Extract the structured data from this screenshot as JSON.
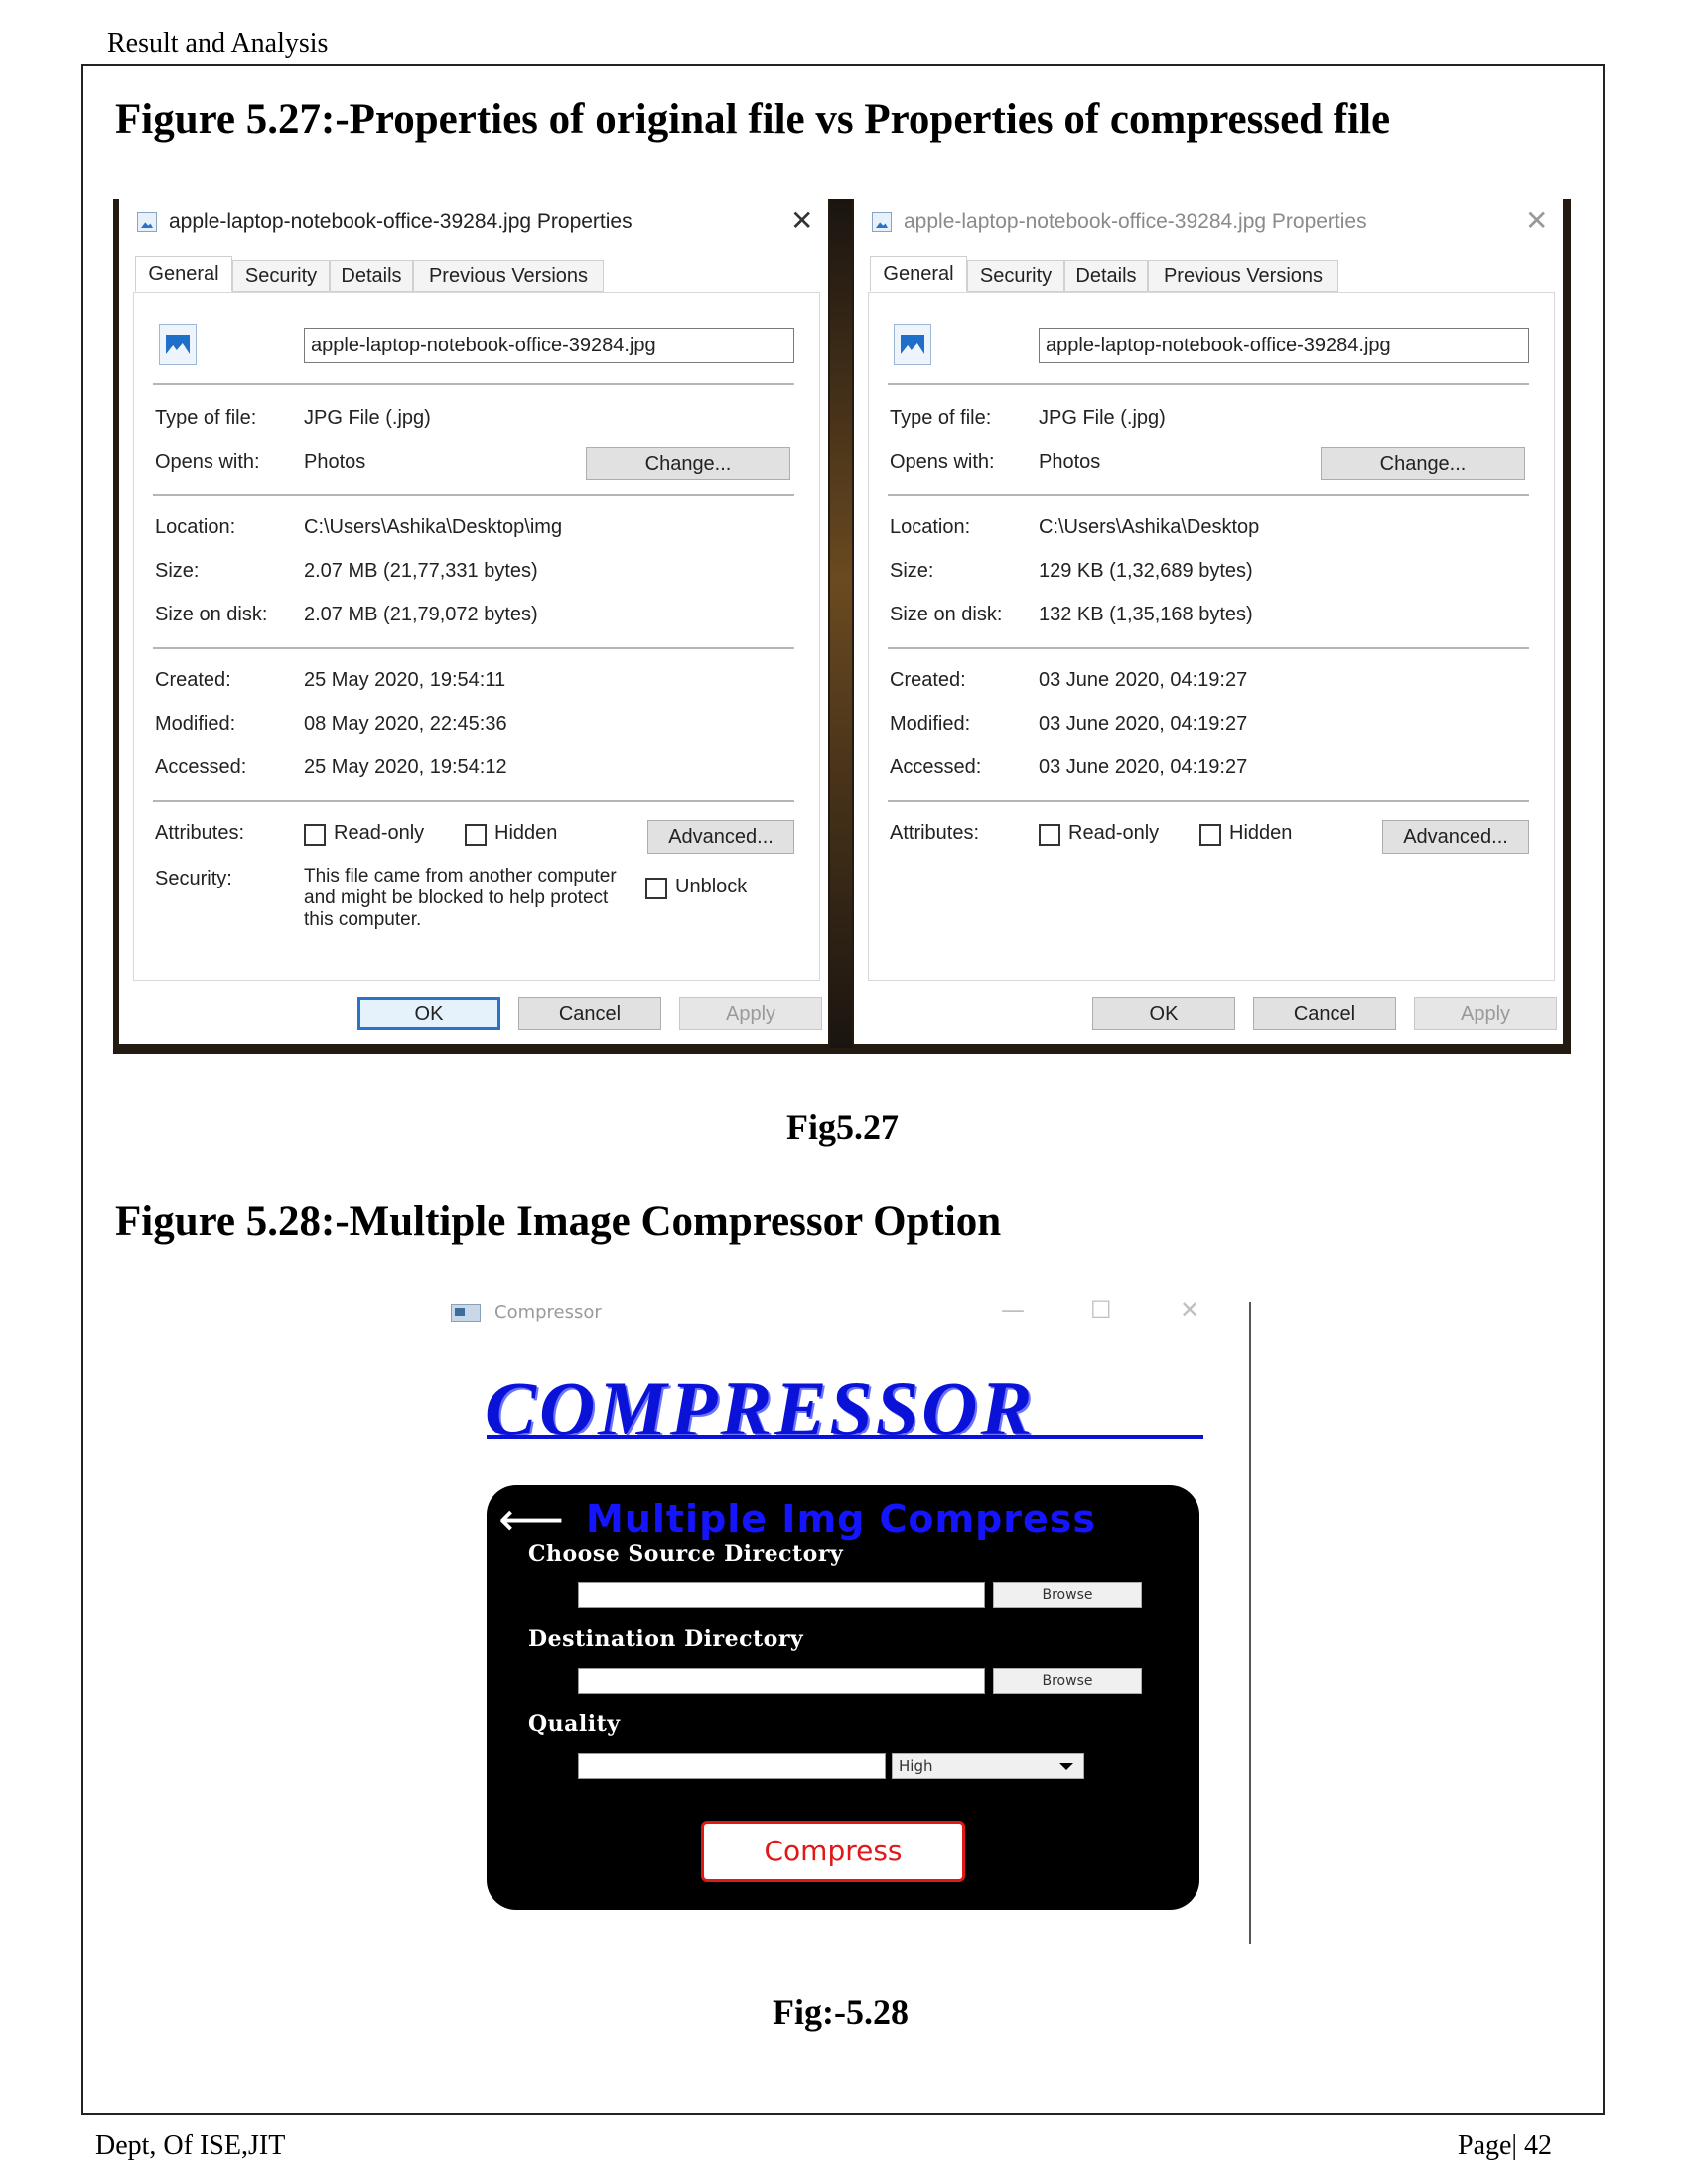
{
  "page": {
    "header": "Result and Analysis",
    "footer_left": "Dept, Of ISE,JIT",
    "footer_right": "Page| 42"
  },
  "figure_527": {
    "title": "Figure 5.27:-Properties of original file vs Properties of compressed file",
    "caption": "Fig5.27",
    "left_dialog": {
      "title": "apple-laptop-notebook-office-39284.jpg Properties",
      "tabs": [
        "General",
        "Security",
        "Details",
        "Previous Versions"
      ],
      "filename": "apple-laptop-notebook-office-39284.jpg",
      "type_label": "Type of file:",
      "type_value": "JPG File (.jpg)",
      "opens_label": "Opens with:",
      "opens_value": "Photos",
      "change_button": "Change...",
      "location_label": "Location:",
      "location_value": "C:\\Users\\Ashika\\Desktop\\img",
      "size_label": "Size:",
      "size_value": "2.07 MB (21,77,331 bytes)",
      "size_disk_label": "Size on disk:",
      "size_disk_value": "2.07 MB (21,79,072 bytes)",
      "created_label": "Created:",
      "created_value": "25 May 2020, 19:54:11",
      "modified_label": "Modified:",
      "modified_value": "08 May 2020, 22:45:36",
      "accessed_label": "Accessed:",
      "accessed_value": "25 May 2020, 19:54:12",
      "attributes_label": "Attributes:",
      "readonly_label": "Read-only",
      "hidden_label": "Hidden",
      "advanced_button": "Advanced...",
      "security_label": "Security:",
      "security_text": "This file came from another computer and might be blocked to help protect this computer.",
      "unblock_label": "Unblock",
      "ok_button": "OK",
      "cancel_button": "Cancel",
      "apply_button": "Apply"
    },
    "right_dialog": {
      "title": "apple-laptop-notebook-office-39284.jpg Properties",
      "tabs": [
        "General",
        "Security",
        "Details",
        "Previous Versions"
      ],
      "filename": "apple-laptop-notebook-office-39284.jpg",
      "type_label": "Type of file:",
      "type_value": "JPG File (.jpg)",
      "opens_label": "Opens with:",
      "opens_value": "Photos",
      "change_button": "Change...",
      "location_label": "Location:",
      "location_value": "C:\\Users\\Ashika\\Desktop",
      "size_label": "Size:",
      "size_value": "129 KB (1,32,689 bytes)",
      "size_disk_label": "Size on disk:",
      "size_disk_value": "132 KB (1,35,168 bytes)",
      "created_label": "Created:",
      "created_value": "03 June 2020, 04:19:27",
      "modified_label": "Modified:",
      "modified_value": "03 June 2020, 04:19:27",
      "accessed_label": "Accessed:",
      "accessed_value": "03 June 2020, 04:19:27",
      "attributes_label": "Attributes:",
      "readonly_label": "Read-only",
      "hidden_label": "Hidden",
      "advanced_button": "Advanced...",
      "ok_button": "OK",
      "cancel_button": "Cancel",
      "apply_button": "Apply"
    }
  },
  "figure_528": {
    "title": "Figure 5.28:-Multiple Image Compressor Option",
    "caption": "Fig:-5.28",
    "window": {
      "title": "Compressor",
      "minimize": "—",
      "maximize": "☐",
      "close": "✕",
      "logo": "COMPRESSOR",
      "back_arrow": "⟵",
      "panel_title": "Multiple Img Compress",
      "source_label": "Choose Source Directory",
      "source_value": "",
      "browse_label": "Browse",
      "dest_label": "Destination Directory",
      "dest_value": "",
      "quality_label": "Quality",
      "quality_value": "",
      "quality_selected": "High",
      "compress_button": "Compress"
    }
  }
}
